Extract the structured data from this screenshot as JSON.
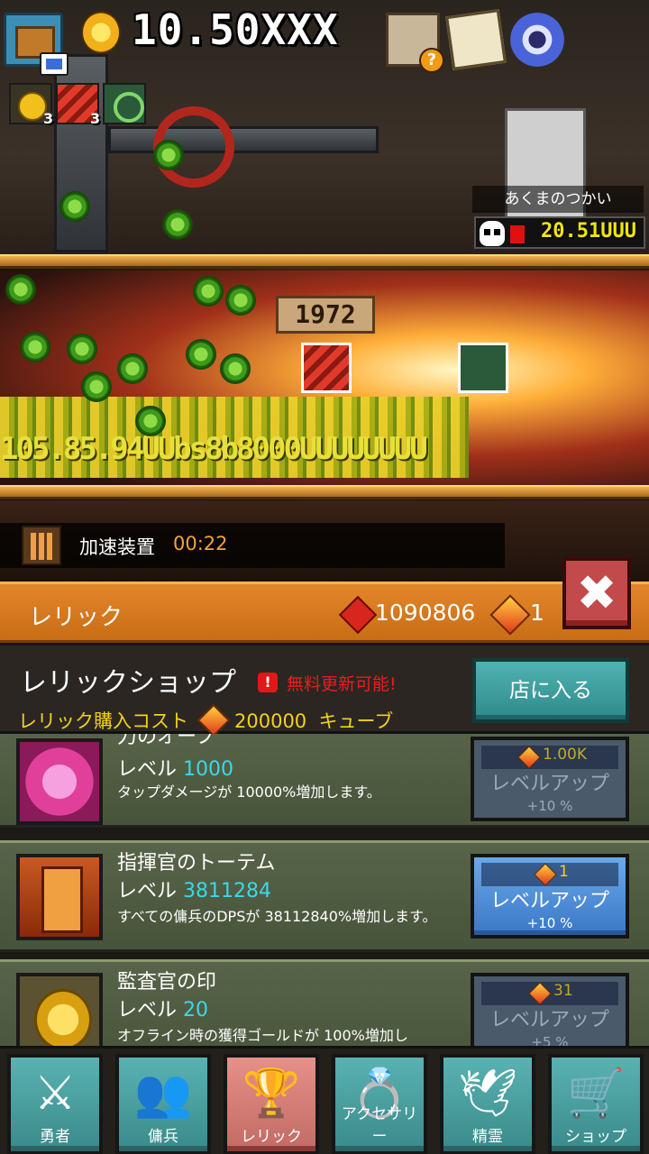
{
  "hud": {
    "gold": "10.50XXX",
    "buffs": [
      {
        "name": "coin-buff",
        "count": "3"
      },
      {
        "name": "sword-buff",
        "count": "3"
      },
      {
        "name": "green-buff",
        "count": ""
      }
    ],
    "quest_badge": "?"
  },
  "battle": {
    "boss_name": "あくまのつかい",
    "boss_hp": "20.51UUU",
    "stage_number": "1972",
    "damage_text": "105.85.94UUbs8b8000UUUUUUUU",
    "accelerator_label": "加速装置",
    "accelerator_time": "00:22"
  },
  "relic_header": {
    "title": "レリック",
    "ruby_count": "1090806",
    "cube_count": "1",
    "close_symbol": "✖"
  },
  "shop": {
    "title": "レリックショップ",
    "alert": "!",
    "free_refresh": "無料更新可能!",
    "cost_label": "レリック購入コスト",
    "cost_value": "200000",
    "cost_unit": "キューブ",
    "enter_label": "店に入る"
  },
  "relics": [
    {
      "name": "力のオーブ",
      "level_label": "レベル",
      "level": "1000",
      "description": "タップダメージが 10000%増加します。",
      "button": {
        "cost": "1.00K",
        "label": "レベルアップ",
        "pct": "+10 %",
        "state": "disabled"
      }
    },
    {
      "name": "指揮官のトーテム",
      "level_label": "レベル",
      "level": "3811284",
      "description": "すべての傭兵のDPSが 38112840%増加します。",
      "button": {
        "cost": "1",
        "label": "レベルアップ",
        "pct": "+10 %",
        "state": "active"
      }
    },
    {
      "name": "監査官の印",
      "level_label": "レベル",
      "level": "20",
      "description": "オフライン時の獲得ゴールドが 100%増加し",
      "button": {
        "cost": "31",
        "label": "レベルアップ",
        "pct": "+5 %",
        "state": "disabled"
      }
    }
  ],
  "nav": {
    "tabs": [
      {
        "label": "勇者",
        "icon": "sword-icon"
      },
      {
        "label": "傭兵",
        "icon": "mercenary-icon"
      },
      {
        "label": "レリック",
        "icon": "trophy-icon"
      },
      {
        "label": "アクセサリー",
        "icon": "ring-icon"
      },
      {
        "label": "精霊",
        "icon": "spirit-icon"
      },
      {
        "label": "ショップ",
        "icon": "cart-icon"
      }
    ],
    "selected": "レリック"
  },
  "colors": {
    "relic_header": "#d97a22",
    "level_value": "#3ad8e8",
    "free_refresh": "#e81e1e",
    "cost_text": "#f2d21a",
    "nav_tab": "#4aa0a0",
    "nav_selected": "#d67e78",
    "button_active": "#4a8ed8"
  }
}
